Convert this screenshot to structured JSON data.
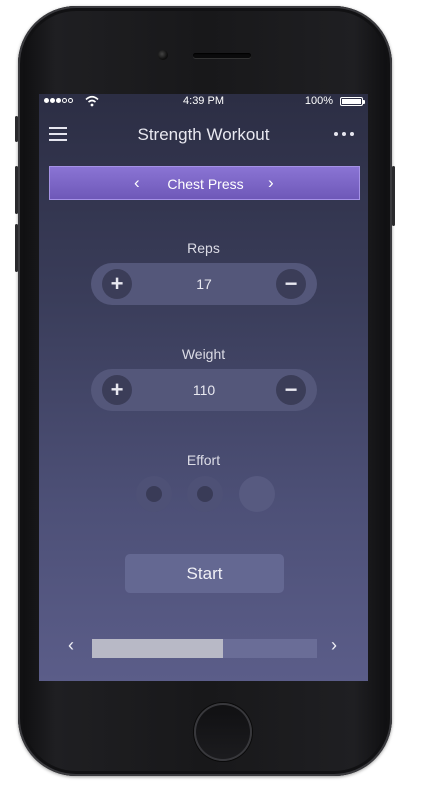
{
  "status_bar": {
    "time": "4:39 PM",
    "battery": "100%",
    "signal_icon": "signal-dots-icon",
    "wifi_icon": "wifi-icon"
  },
  "header": {
    "title": "Strength Workout",
    "menu_icon": "hamburger-menu-icon",
    "more_icon": "more-dots-icon"
  },
  "exercise": {
    "name": "Chest Press",
    "prev_icon": "chevron-left-icon",
    "next_icon": "chevron-right-icon",
    "prev": "‹",
    "next": "›"
  },
  "reps": {
    "label": "Reps",
    "value": "17",
    "plus": "+",
    "minus": "−"
  },
  "weight": {
    "label": "Weight",
    "value": "110",
    "plus": "+",
    "minus": "−"
  },
  "effort": {
    "label": "Effort",
    "levels": [
      true,
      true,
      false
    ]
  },
  "start": {
    "label": "Start"
  },
  "progress": {
    "fraction": 0.58,
    "prev": "‹",
    "next": "›"
  },
  "colors": {
    "accent": "#7b66c8",
    "screen_bg": "#3a3d5a"
  }
}
